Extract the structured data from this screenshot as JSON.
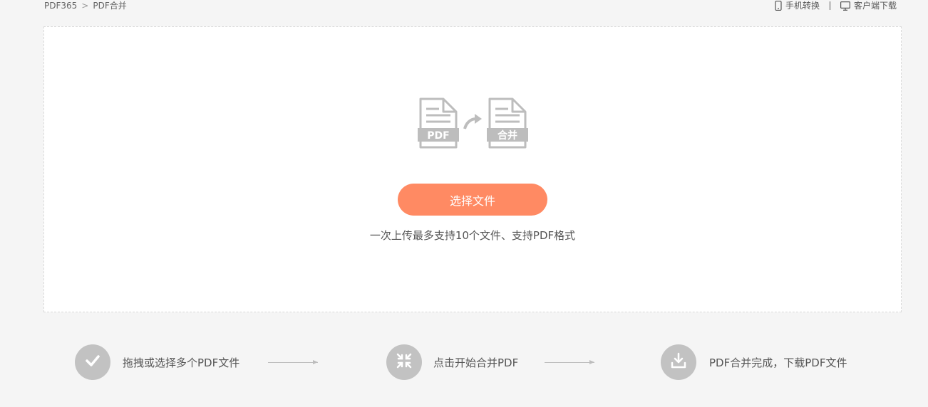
{
  "breadcrumb": {
    "home": "PDF365",
    "separator": ">",
    "current": "PDF合并"
  },
  "toplinks": {
    "mobile": "手机转换",
    "desktop": "客户端下载"
  },
  "upload": {
    "source_badge": "PDF",
    "target_badge": "合并",
    "button_label": "选择文件",
    "hint": "一次上传最多支持10个文件、支持PDF格式"
  },
  "steps": [
    {
      "icon": "check-icon",
      "label": "拖拽或选择多个PDF文件"
    },
    {
      "icon": "merge-icon",
      "label": "点击开始合并PDF"
    },
    {
      "icon": "download-icon",
      "label": "PDF合并完成，下载PDF文件"
    }
  ],
  "colors": {
    "accent": "#ff8a63",
    "page_background": "#f5f5f5",
    "step_circle": "#c2c2c2",
    "icon_gray": "#bdbdbd"
  }
}
